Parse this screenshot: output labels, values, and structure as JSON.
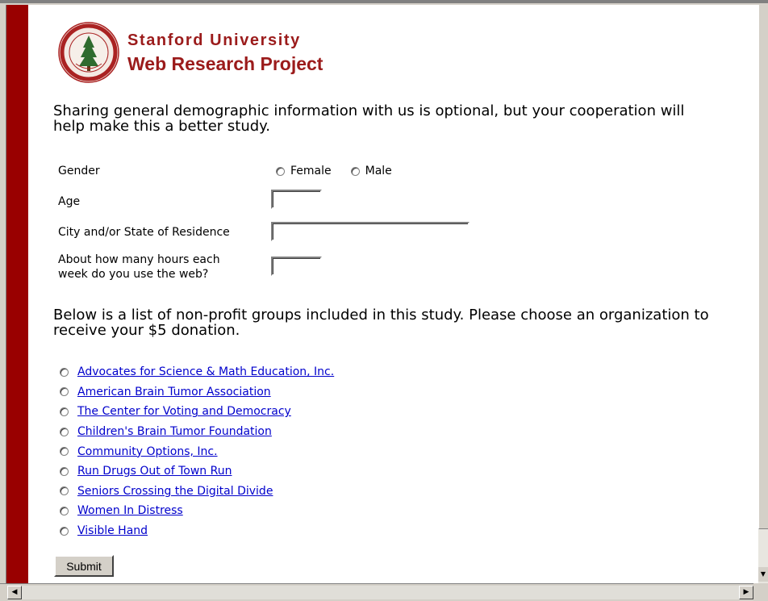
{
  "header": {
    "brand_line1": "Stanford University",
    "brand_line2": "Web Research Project",
    "seal_text": "LELAND STANFORD JUNIOR UNIVERSITY"
  },
  "intro": {
    "text": "Sharing general demographic information with us is optional, but your cooperation will help make this a better study."
  },
  "demographics": {
    "gender_label": "Gender",
    "gender_options": [
      "Female",
      "Male"
    ],
    "age_label": "Age",
    "age_value": "",
    "city_label": "City and/or State of Residence",
    "city_value": "",
    "hours_label_line1": "About how many hours each",
    "hours_label_line2": "week do you use the web?",
    "hours_value": ""
  },
  "organizations": {
    "intro": "Below is a list of non-profit groups included in this study. Please choose an organization to receive your $5 donation.",
    "items": [
      "Advocates for Science & Math Education, Inc.",
      "American Brain Tumor Association",
      "The Center for Voting and Democracy",
      "Children's Brain Tumor Foundation",
      "Community Options, Inc.",
      "Run Drugs Out of Town Run",
      "Seniors Crossing the Digital Divide",
      "Women In Distress",
      "Visible Hand"
    ]
  },
  "submit_label": "Submit",
  "colors": {
    "accent_bar": "#990000",
    "brand_text": "#9b1b1b",
    "link": "#0000cc"
  }
}
